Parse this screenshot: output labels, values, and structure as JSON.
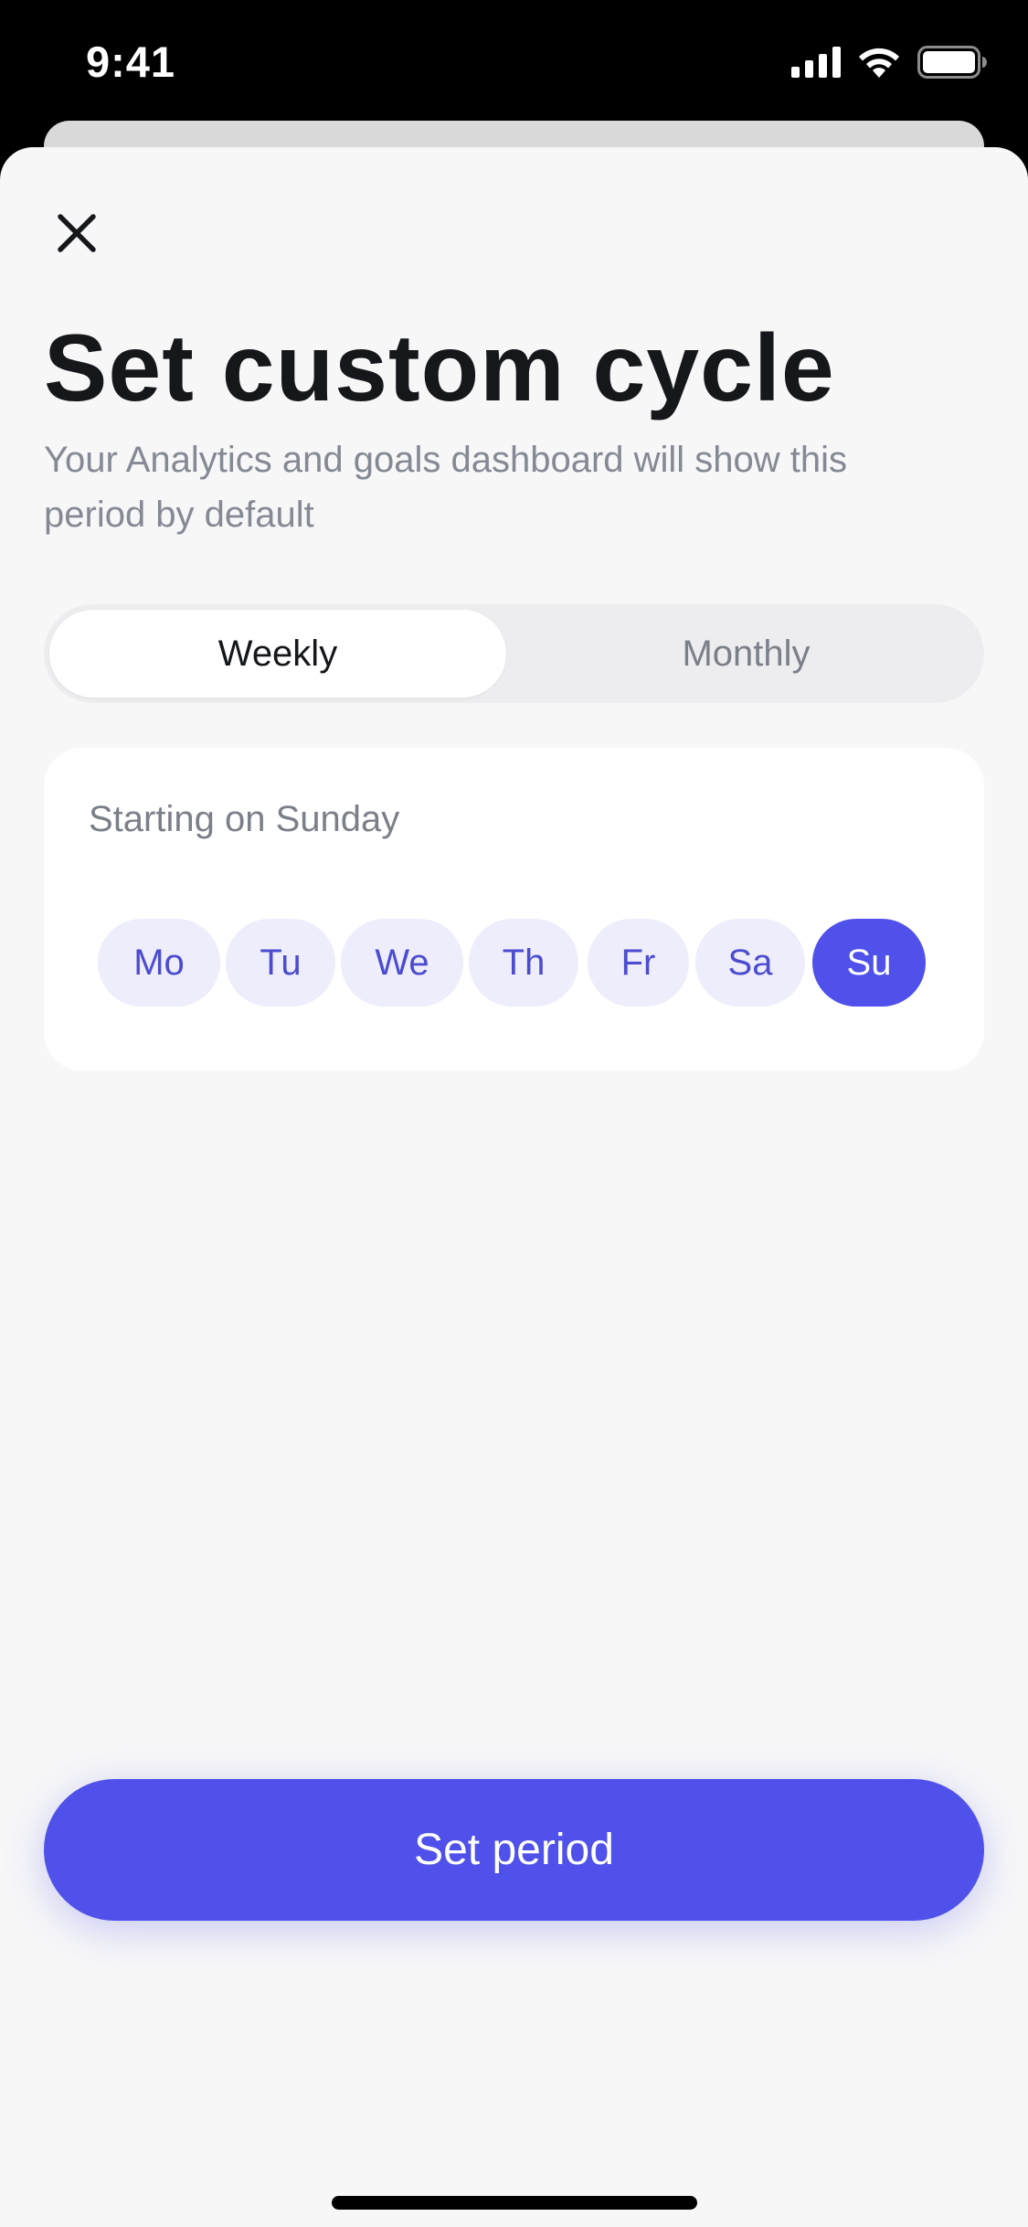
{
  "status_bar": {
    "time": "9:41",
    "icons": [
      "cellular-signal-icon",
      "wifi-icon",
      "battery-icon"
    ]
  },
  "header": {
    "close_icon": "close-icon",
    "title": "Set custom cycle",
    "subtitle": "Your Analytics and goals dashboard will show this period by default"
  },
  "period_toggle": {
    "options": [
      {
        "label": "Weekly",
        "selected": true
      },
      {
        "label": "Monthly",
        "selected": false
      }
    ]
  },
  "start_day": {
    "label": "Starting on Sunday",
    "days": [
      {
        "label": "Mo",
        "selected": false
      },
      {
        "label": "Tu",
        "selected": false
      },
      {
        "label": "We",
        "selected": false
      },
      {
        "label": "Th",
        "selected": false
      },
      {
        "label": "Fr",
        "selected": false
      },
      {
        "label": "Sa",
        "selected": false
      },
      {
        "label": "Su",
        "selected": true
      }
    ]
  },
  "footer": {
    "primary_button": "Set period"
  },
  "colors": {
    "accent": "#4f51ea",
    "pill_bg": "#ededfb",
    "pill_text": "#4b4ccf",
    "sheet_bg": "#f7f7f8",
    "title_text": "#16171b",
    "muted_text": "#858993"
  }
}
